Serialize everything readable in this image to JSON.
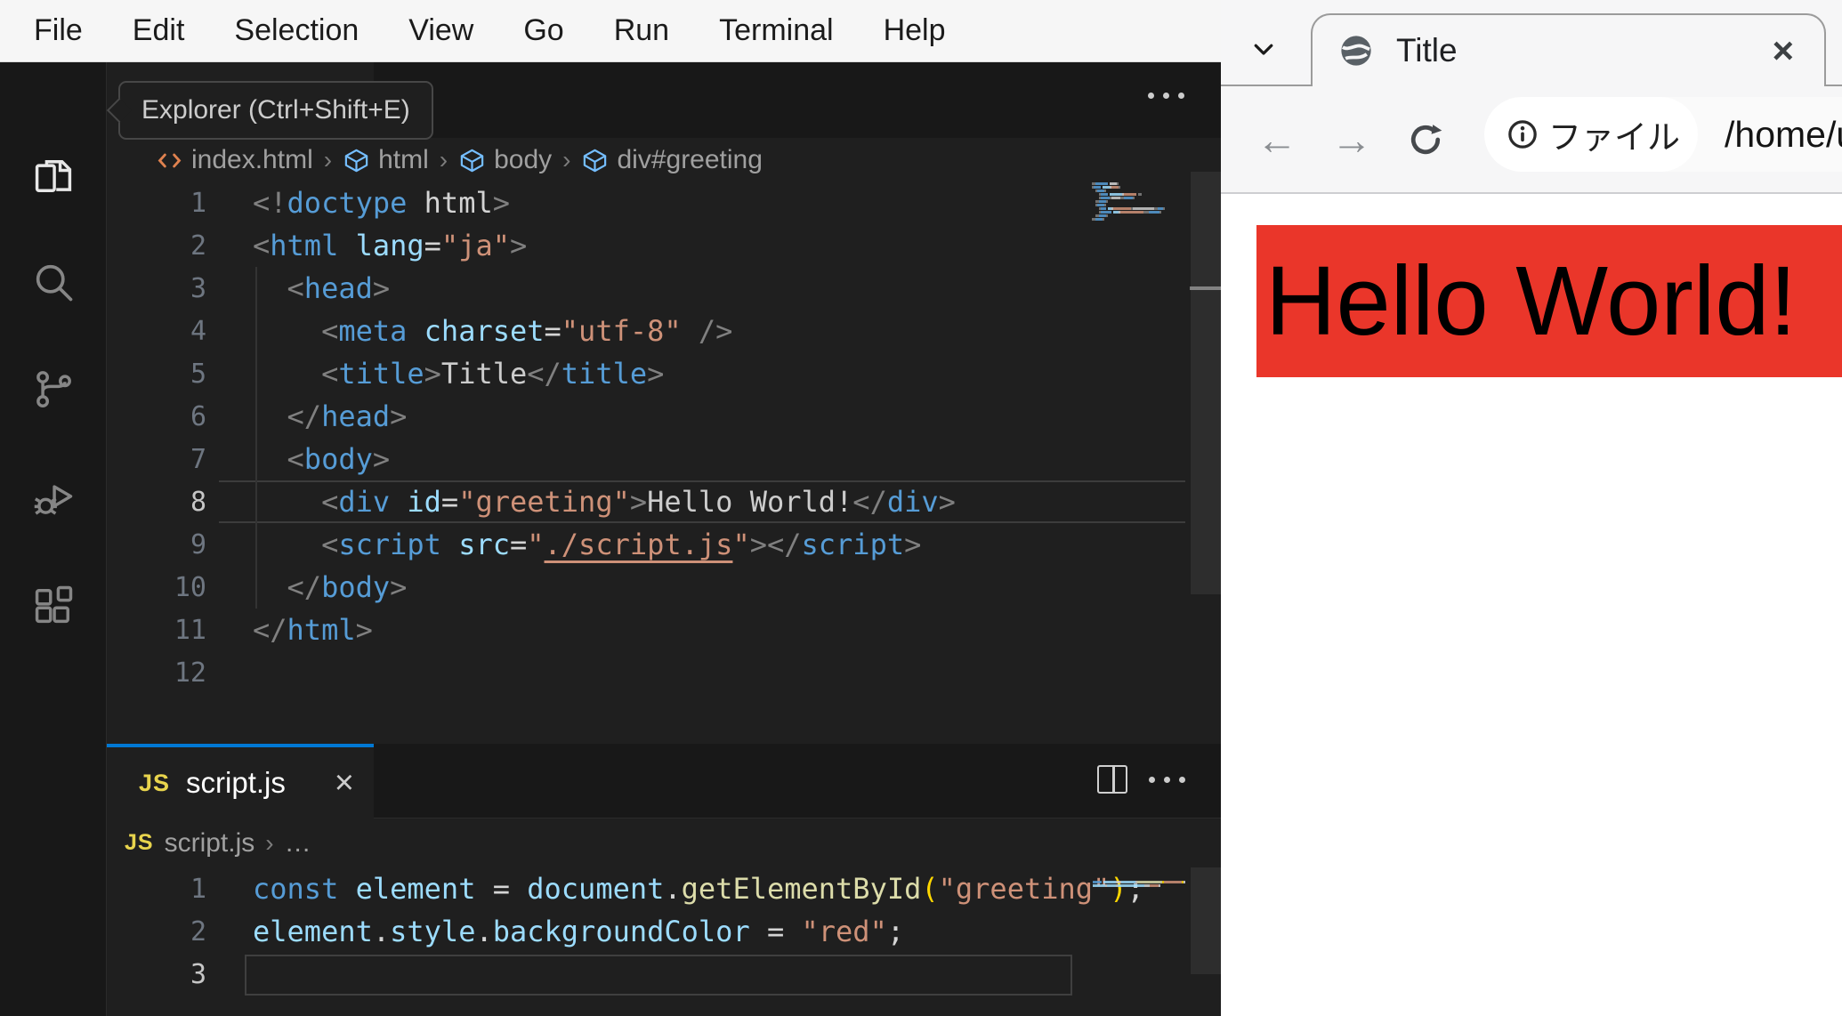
{
  "vscode": {
    "menu_bar": {
      "items": [
        "File",
        "Edit",
        "Selection",
        "View",
        "Go",
        "Run",
        "Terminal",
        "Help"
      ]
    },
    "activity_bar": {
      "items": [
        {
          "icon": "explorer-icon",
          "active": true
        },
        {
          "icon": "search-icon",
          "active": false
        },
        {
          "icon": "source-control-icon",
          "active": false
        },
        {
          "icon": "run-debug-icon",
          "active": false
        },
        {
          "icon": "extensions-icon",
          "active": false
        }
      ]
    },
    "tooltip": {
      "text": "Explorer (Ctrl+Shift+E)"
    },
    "editor_html": {
      "breadcrumbs": [
        {
          "label": "index.html",
          "icon": "html-file-icon"
        },
        {
          "label": "html",
          "icon": "symbol-element-icon"
        },
        {
          "label": "body",
          "icon": "symbol-element-icon"
        },
        {
          "label": "div#greeting",
          "icon": "symbol-element-icon"
        }
      ],
      "active_line": 8,
      "lines": [
        [
          [
            "<!",
            "punc"
          ],
          [
            "doctype",
            "kw"
          ],
          [
            " ",
            "plain"
          ],
          [
            "html",
            "plain"
          ],
          [
            ">",
            "punc"
          ]
        ],
        [
          [
            "<",
            "punc"
          ],
          [
            "html",
            "tag"
          ],
          [
            " ",
            "plain"
          ],
          [
            "lang",
            "attr"
          ],
          [
            "=",
            "plain"
          ],
          [
            "\"ja\"",
            "str"
          ],
          [
            ">",
            "punc"
          ]
        ],
        [
          [
            "  ",
            "plain"
          ],
          [
            "<",
            "punc"
          ],
          [
            "head",
            "tag"
          ],
          [
            ">",
            "punc"
          ]
        ],
        [
          [
            "    ",
            "plain"
          ],
          [
            "<",
            "punc"
          ],
          [
            "meta",
            "tag"
          ],
          [
            " ",
            "plain"
          ],
          [
            "charset",
            "attr"
          ],
          [
            "=",
            "plain"
          ],
          [
            "\"utf-8\"",
            "str"
          ],
          [
            " ",
            "plain"
          ],
          [
            "/>",
            "punc"
          ]
        ],
        [
          [
            "    ",
            "plain"
          ],
          [
            "<",
            "punc"
          ],
          [
            "title",
            "tag"
          ],
          [
            ">",
            "punc"
          ],
          [
            "Title",
            "text"
          ],
          [
            "</",
            "punc"
          ],
          [
            "title",
            "tag"
          ],
          [
            ">",
            "punc"
          ]
        ],
        [
          [
            "  ",
            "plain"
          ],
          [
            "</",
            "punc"
          ],
          [
            "head",
            "tag"
          ],
          [
            ">",
            "punc"
          ]
        ],
        [
          [
            "  ",
            "plain"
          ],
          [
            "<",
            "punc"
          ],
          [
            "body",
            "tag"
          ],
          [
            ">",
            "punc"
          ]
        ],
        [
          [
            "    ",
            "plain"
          ],
          [
            "<",
            "punc"
          ],
          [
            "div",
            "tag"
          ],
          [
            " ",
            "plain"
          ],
          [
            "id",
            "attr"
          ],
          [
            "=",
            "plain"
          ],
          [
            "\"greeting\"",
            "str"
          ],
          [
            ">",
            "punc"
          ],
          [
            "Hello World!",
            "text"
          ],
          [
            "</",
            "punc"
          ],
          [
            "div",
            "tag"
          ],
          [
            ">",
            "punc"
          ]
        ],
        [
          [
            "    ",
            "plain"
          ],
          [
            "<",
            "punc"
          ],
          [
            "script",
            "tag"
          ],
          [
            " ",
            "plain"
          ],
          [
            "src",
            "attr"
          ],
          [
            "=",
            "plain"
          ],
          [
            "\"",
            "str"
          ],
          [
            "./script.js",
            "link"
          ],
          [
            "\"",
            "str"
          ],
          [
            ">",
            "punc"
          ],
          [
            "</",
            "punc"
          ],
          [
            "script",
            "tag"
          ],
          [
            ">",
            "punc"
          ]
        ],
        [
          [
            "  ",
            "plain"
          ],
          [
            "</",
            "punc"
          ],
          [
            "body",
            "tag"
          ],
          [
            ">",
            "punc"
          ]
        ],
        [
          [
            "</",
            "punc"
          ],
          [
            "html",
            "tag"
          ],
          [
            ">",
            "punc"
          ]
        ],
        []
      ]
    },
    "editor_js": {
      "tab": {
        "label": "script.js",
        "badge": "JS",
        "close": "×"
      },
      "breadcrumbs": [
        {
          "label": "script.js",
          "icon": "js-badge-icon"
        },
        {
          "label": "…",
          "icon": null
        }
      ],
      "active_line": 3,
      "lines": [
        [
          [
            "const",
            "kw"
          ],
          [
            " ",
            "plain"
          ],
          [
            "element",
            "var"
          ],
          [
            " = ",
            "plain"
          ],
          [
            "document",
            "var"
          ],
          [
            ".",
            "plain"
          ],
          [
            "getElementById",
            "fn"
          ],
          [
            "(",
            "paren"
          ],
          [
            "\"greeting\"",
            "str"
          ],
          [
            ")",
            "paren"
          ],
          [
            ";",
            "plain"
          ]
        ],
        [
          [
            "element",
            "var"
          ],
          [
            ".",
            "plain"
          ],
          [
            "style",
            "var"
          ],
          [
            ".",
            "plain"
          ],
          [
            "backgroundColor",
            "var"
          ],
          [
            " = ",
            "plain"
          ],
          [
            "\"red\"",
            "str"
          ],
          [
            ";",
            "plain"
          ]
        ],
        []
      ]
    },
    "colors": {
      "accent_tab_indicator": "#0078d4",
      "js_badge": "#e8d44d"
    }
  },
  "browser": {
    "tab": {
      "title": "Title",
      "close": "×"
    },
    "toolbar": {
      "chip_label": "ファイル",
      "url": "/home/u"
    },
    "page": {
      "text": "Hello World!",
      "highlight_color": "#ea362a"
    }
  }
}
